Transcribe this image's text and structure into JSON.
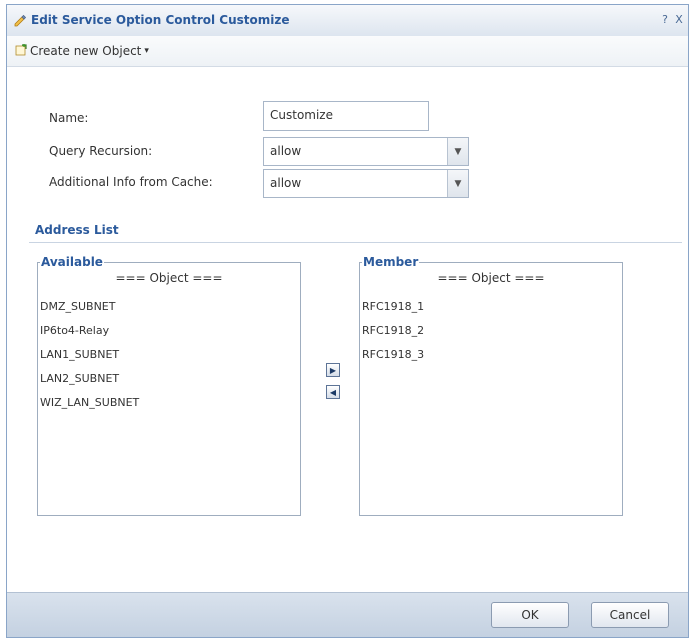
{
  "dialog": {
    "title": "Edit Service Option Control Customize",
    "help_label": "?",
    "close_label": "X"
  },
  "toolbar": {
    "create_label": "Create new Object"
  },
  "form": {
    "name_label": "Name:",
    "name_value": "Customize",
    "query_recursion_label": "Query Recursion:",
    "query_recursion_value": "allow",
    "additional_info_label": "Additional Info from Cache:",
    "additional_info_value": "allow"
  },
  "address_list": {
    "section_title": "Address List",
    "available_title": "Available",
    "available_header": "=== Object ===",
    "available_items": [
      "DMZ_SUBNET",
      "IP6to4-Relay",
      "LAN1_SUBNET",
      "LAN2_SUBNET",
      "WIZ_LAN_SUBNET"
    ],
    "member_title": "Member",
    "member_header": "=== Object ===",
    "member_items": [
      "RFC1918_1",
      "RFC1918_2",
      "RFC1918_3"
    ]
  },
  "footer": {
    "ok_label": "OK",
    "cancel_label": "Cancel"
  },
  "icons": {
    "title": "edit-icon",
    "toolbar": "create-object-icon",
    "dropdown": "chevron-down-icon",
    "add": "arrow-right-icon",
    "remove": "arrow-left-icon"
  },
  "colors": {
    "accent": "#2b5a9c",
    "border": "#8aa5c8",
    "footer_bg": "#c4d1e1"
  }
}
